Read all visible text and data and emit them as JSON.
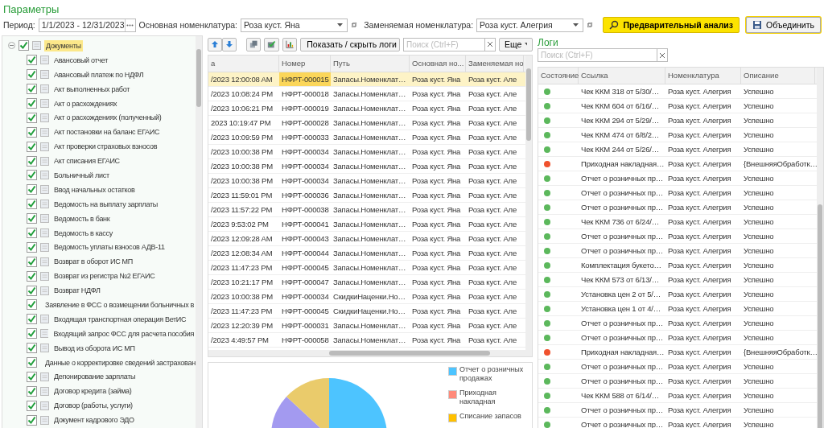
{
  "title": "Параметры",
  "filters": {
    "period_label": "Период:",
    "period": "1/1/2023 - 12/31/2023",
    "main_label": "Основная номенклатура:",
    "main": "Роза куст. Яна",
    "replace_label": "Заменяемая номенклатура:",
    "replace": "Роза куст. Алегрия"
  },
  "actions": [
    {
      "label": "Предварительный анализ",
      "kind": "primary"
    },
    {
      "label": "Объединить",
      "kind": "save"
    }
  ],
  "tree": {
    "label": "Документы",
    "checked": true,
    "expanded": true,
    "selected": true,
    "children": [
      {
        "label": "Авансовый отчет",
        "checked": true,
        "selected": false
      },
      {
        "label": "Авансовый платеж по НДФЛ",
        "checked": true,
        "selected": false
      },
      {
        "label": "Акт выполненных работ",
        "checked": true,
        "selected": false
      },
      {
        "label": "Акт о расхождениях",
        "checked": true,
        "selected": false
      },
      {
        "label": "Акт о расхождениях (полученный)",
        "checked": true,
        "selected": false
      },
      {
        "label": "Акт постановки на баланс ЕГАИС",
        "checked": true,
        "selected": false
      },
      {
        "label": "Акт проверки страховых взносов",
        "checked": true,
        "selected": false
      },
      {
        "label": "Акт списания ЕГАИС",
        "checked": true,
        "selected": false
      },
      {
        "label": "Больничный лист",
        "checked": true,
        "selected": false
      },
      {
        "label": "Ввод начальных остатков",
        "checked": true,
        "selected": false
      },
      {
        "label": "Ведомость на выплату зарплаты",
        "checked": true,
        "selected": false
      },
      {
        "label": "Ведомость в банк",
        "checked": true,
        "selected": false
      },
      {
        "label": "Ведомость в кассу",
        "checked": true,
        "selected": false
      },
      {
        "label": "Ведомость уплаты взносов АДВ-11",
        "checked": true,
        "selected": false
      },
      {
        "label": "Возврат в оборот ИС МП",
        "checked": true,
        "selected": false
      },
      {
        "label": "Возврат из регистра №2 ЕГАИС",
        "checked": true,
        "selected": false
      },
      {
        "label": "Возврат НДФЛ",
        "checked": true,
        "selected": false
      },
      {
        "label": "Заявление в ФСС о возмещении больничных в",
        "checked": true,
        "selected": false
      },
      {
        "label": "Входящая транспортная операция ВетИС",
        "checked": true,
        "selected": false
      },
      {
        "label": "Входящий запрос ФСС для расчета пособия",
        "checked": true,
        "selected": false
      },
      {
        "label": "Вывод из оборота ИС МП",
        "checked": true,
        "selected": false
      },
      {
        "label": "Данные о корректировке сведений застрахован",
        "checked": true,
        "selected": false
      },
      {
        "label": "Депонирование зарплаты",
        "checked": true,
        "selected": false
      },
      {
        "label": "Договор кредита (займа)",
        "checked": true,
        "selected": false
      },
      {
        "label": "Договор (работы, услуги)",
        "checked": true,
        "selected": false
      },
      {
        "label": "Документ кадрового ЭДО",
        "checked": true,
        "selected": false
      }
    ]
  },
  "toolbar": {
    "toggle_logs": "Показать / скрыть логи",
    "search_placeholder": "Поиск (Ctrl+F)",
    "more": "Еще"
  },
  "table": {
    "columns": [
      "а",
      "Номер",
      "Путь",
      "Основная но...",
      "Заменяемая но"
    ],
    "rows": [
      {
        "date": "/2023 12:00:08 AM",
        "number": "НФРТ-000015",
        "path": "Запасы.Номенклат…",
        "main": "Роза куст. Яна",
        "replace": "Роза куст. Але",
        "selected": true
      },
      {
        "date": "/2023 10:08:24 PM",
        "number": "НФРТ-000018",
        "path": "Запасы.Номенклат…",
        "main": "Роза куст. Яна",
        "replace": "Роза куст. Але",
        "selected": false
      },
      {
        "date": "/2023 10:06:21 PM",
        "number": "НФРТ-000019",
        "path": "Запасы.Номенклат…",
        "main": "Роза куст. Яна",
        "replace": "Роза куст. Але",
        "selected": false
      },
      {
        "date": "2023 10:19:47 PM",
        "number": "НФРТ-000028",
        "path": "Запасы.Номенклат…",
        "main": "Роза куст. Яна",
        "replace": "Роза куст. Але",
        "selected": false
      },
      {
        "date": "/2023 10:09:59 PM",
        "number": "НФРТ-000033",
        "path": "Запасы.Номенклат…",
        "main": "Роза куст. Яна",
        "replace": "Роза куст. Але",
        "selected": false
      },
      {
        "date": "/2023 10:00:38 PM",
        "number": "НФРТ-000034",
        "path": "Запасы.Номенклат…",
        "main": "Роза куст. Яна",
        "replace": "Роза куст. Але",
        "selected": false
      },
      {
        "date": "/2023 10:00:38 PM",
        "number": "НФРТ-000034",
        "path": "Запасы.Номенклат…",
        "main": "Роза куст. Яна",
        "replace": "Роза куст. Але",
        "selected": false
      },
      {
        "date": "/2023 10:00:38 PM",
        "number": "НФРТ-000034",
        "path": "Запасы.Номенклат…",
        "main": "Роза куст. Яна",
        "replace": "Роза куст. Але",
        "selected": false
      },
      {
        "date": "/2023 11:59:01 PM",
        "number": "НФРТ-000036",
        "path": "Запасы.Номенклат…",
        "main": "Роза куст. Яна",
        "replace": "Роза куст. Але",
        "selected": false
      },
      {
        "date": "/2023 11:57:22 PM",
        "number": "НФРТ-000038",
        "path": "Запасы.Номенклат…",
        "main": "Роза куст. Яна",
        "replace": "Роза куст. Але",
        "selected": false
      },
      {
        "date": "/2023 9:53:02 PM",
        "number": "НФРТ-000041",
        "path": "Запасы.Номенклат…",
        "main": "Роза куст. Яна",
        "replace": "Роза куст. Але",
        "selected": false
      },
      {
        "date": "/2023 12:09:28 AM",
        "number": "НФРТ-000043",
        "path": "Запасы.Номенклат…",
        "main": "Роза куст. Яна",
        "replace": "Роза куст. Але",
        "selected": false
      },
      {
        "date": "/2023 12:08:34 AM",
        "number": "НФРТ-000044",
        "path": "Запасы.Номенклат…",
        "main": "Роза куст. Яна",
        "replace": "Роза куст. Але",
        "selected": false
      },
      {
        "date": "/2023 11:47:23 PM",
        "number": "НФРТ-000045",
        "path": "Запасы.Номенклат…",
        "main": "Роза куст. Яна",
        "replace": "Роза куст. Але",
        "selected": false
      },
      {
        "date": "/2023 10:21:17 PM",
        "number": "НФРТ-000047",
        "path": "Запасы.Номенклат…",
        "main": "Роза куст. Яна",
        "replace": "Роза куст. Але",
        "selected": false
      },
      {
        "date": "/2023 10:00:38 PM",
        "number": "НФРТ-000034",
        "path": "СкидкиНаценки.Но…",
        "main": "Роза куст. Яна",
        "replace": "Роза куст. Але",
        "selected": false
      },
      {
        "date": "/2023 11:47:23 PM",
        "number": "НФРТ-000045",
        "path": "СкидкиНаценки.Но…",
        "main": "Роза куст. Яна",
        "replace": "Роза куст. Але",
        "selected": false
      },
      {
        "date": "/2023 12:20:39 PM",
        "number": "НФРТ-000031",
        "path": "Запасы.Номенклат…",
        "main": "Роза куст. Яна",
        "replace": "Роза куст. Але",
        "selected": false
      },
      {
        "date": "/2023 4:49:57 PM",
        "number": "НФРТ-000058",
        "path": "Запасы.Номенклат…",
        "main": "Роза куст. Яна",
        "replace": "Роза куст. Але",
        "selected": false
      }
    ]
  },
  "chart": {
    "legend": [
      {
        "label": "Отчет о розничных продажах",
        "color": "#4dc4ff"
      },
      {
        "label": "Приходная накладная",
        "color": "#ff8a7a"
      },
      {
        "label": "Списание запасов",
        "color": "#ffc000"
      }
    ]
  },
  "logs": {
    "title": "Логи",
    "search_placeholder": "Поиск (Ctrl+F)",
    "columns": [
      "Состояние",
      "Ссылка",
      "Номенклатура",
      "Описание"
    ],
    "rows": [
      {
        "color": "#5cb85c",
        "link": "Чек ККМ 318 от 5/30/…",
        "item": "Роза куст. Алегрия",
        "description": "Успешно"
      },
      {
        "color": "#5cb85c",
        "link": "Чек ККМ 604 от 6/16/…",
        "item": "Роза куст. Алегрия",
        "description": "Успешно"
      },
      {
        "color": "#5cb85c",
        "link": "Чек ККМ 294 от 5/29/…",
        "item": "Роза куст. Алегрия",
        "description": "Успешно"
      },
      {
        "color": "#5cb85c",
        "link": "Чек ККМ 474 от 6/8/2…",
        "item": "Роза куст. Алегрия",
        "description": "Успешно"
      },
      {
        "color": "#5cb85c",
        "link": "Чек ККМ 244 от 5/26/…",
        "item": "Роза куст. Алегрия",
        "description": "Успешно"
      },
      {
        "color": "#f0522e",
        "link": "Приходная накладная…",
        "item": "Роза куст. Алегрия",
        "description": "{ВнешняяОбработк…"
      },
      {
        "color": "#5cb85c",
        "link": "Отчет о розничных пр…",
        "item": "Роза куст. Алегрия",
        "description": "Успешно"
      },
      {
        "color": "#5cb85c",
        "link": "Отчет о розничных пр…",
        "item": "Роза куст. Алегрия",
        "description": "Успешно"
      },
      {
        "color": "#5cb85c",
        "link": "Отчет о розничных пр…",
        "item": "Роза куст. Алегрия",
        "description": "Успешно"
      },
      {
        "color": "#5cb85c",
        "link": "Чек ККМ 736 от 6/24/…",
        "item": "Роза куст. Алегрия",
        "description": "Успешно"
      },
      {
        "color": "#5cb85c",
        "link": "Отчет о розничных пр…",
        "item": "Роза куст. Алегрия",
        "description": "Успешно"
      },
      {
        "color": "#5cb85c",
        "link": "Отчет о розничных пр…",
        "item": "Роза куст. Алегрия",
        "description": "Успешно"
      },
      {
        "color": "#5cb85c",
        "link": "Комплектация букето…",
        "item": "Роза куст. Алегрия",
        "description": "Успешно"
      },
      {
        "color": "#5cb85c",
        "link": "Чек ККМ 573 от 6/13/…",
        "item": "Роза куст. Алегрия",
        "description": "Успешно"
      },
      {
        "color": "#5cb85c",
        "link": "Установка цен 2 от 5/…",
        "item": "Роза куст. Алегрия",
        "description": "Успешно"
      },
      {
        "color": "#5cb85c",
        "link": "Установка цен 1 от 4/…",
        "item": "Роза куст. Алегрия",
        "description": "Успешно"
      },
      {
        "color": "#5cb85c",
        "link": "Отчет о розничных пр…",
        "item": "Роза куст. Алегрия",
        "description": "Успешно"
      },
      {
        "color": "#5cb85c",
        "link": "Отчет о розничных пр…",
        "item": "Роза куст. Алегрия",
        "description": "Успешно"
      },
      {
        "color": "#f0522e",
        "link": "Приходная накладная…",
        "item": "Роза куст. Алегрия",
        "description": "{ВнешняяОбработк…"
      },
      {
        "color": "#5cb85c",
        "link": "Отчет о розничных пр…",
        "item": "Роза куст. Алегрия",
        "description": "Успешно"
      },
      {
        "color": "#5cb85c",
        "link": "Отчет о розничных пр…",
        "item": "Роза куст. Алегрия",
        "description": "Успешно"
      },
      {
        "color": "#5cb85c",
        "link": "Чек ККМ 588 от 6/14/…",
        "item": "Роза куст. Алегрия",
        "description": "Успешно"
      },
      {
        "color": "#5cb85c",
        "link": "Отчет о розничных пр…",
        "item": "Роза куст. Алегрия",
        "description": "Успешно"
      },
      {
        "color": "#5cb85c",
        "link": "Отчет о розничных пр…",
        "item": "Роза куст. Алегрия",
        "description": "Успешно"
      }
    ]
  }
}
